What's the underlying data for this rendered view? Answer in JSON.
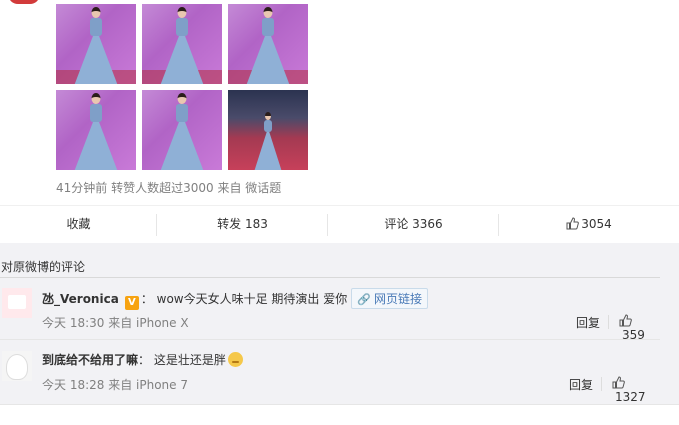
{
  "post": {
    "meta": "41分钟前  转赞人数超过3000 来自 微话题",
    "actions": {
      "favorite": "收藏",
      "repost": "转发 183",
      "comment": "评论 3366",
      "like_count": "3054"
    }
  },
  "comments_section": {
    "title": "对原微博的评论",
    "comments": [
      {
        "user": "氹_Veronica",
        "vip_badge": "V",
        "text": "：  wow今天女人味十足 期待演出 爱你",
        "link_label": "网页链接",
        "time": "今天 18:30 来自 iPhone X",
        "reply": "回复",
        "likes": "359"
      },
      {
        "user": "到底给不给用了嘛",
        "text": "：  这是壮还是胖",
        "time": "今天 18:28 来自 iPhone 7",
        "reply": "回复",
        "likes": "1327"
      }
    ]
  },
  "colors": {
    "link": "#497ab7",
    "vip": "#f7a311",
    "meta": "#808080"
  }
}
